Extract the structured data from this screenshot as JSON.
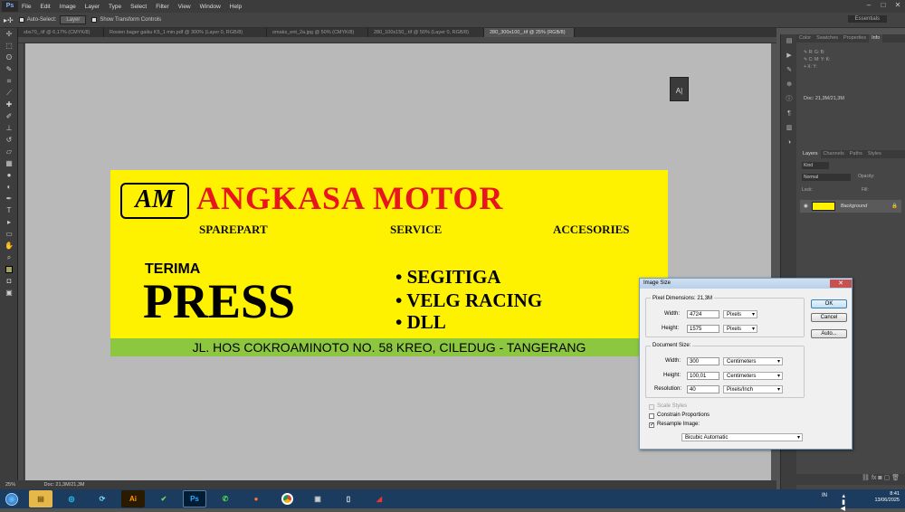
{
  "app": {
    "logo": "Ps",
    "menu": [
      "File",
      "Edit",
      "Image",
      "Layer",
      "Type",
      "Select",
      "Filter",
      "View",
      "Window",
      "Help"
    ]
  },
  "options": {
    "auto_select_label": "Auto-Select:",
    "auto_select_value": "Layer",
    "show_transform_label": "Show Transform Controls",
    "workspace": "Essentials"
  },
  "doc_tabs": [
    "sbs70_.tif @ 6,17% (CMYK/8)",
    "Rosien bager gaiku K5_1 min.pdf @ 300% (Layer 0, RGB/8)",
    "omaks_ent_2a.jpg @ 50% (CMYK/8)",
    "280_100x150_.tif @ 50% (Layer 0, RGB/8)",
    "280_300x100_.tif @ 25% (RGB/8)"
  ],
  "banner": {
    "logo_text": "AM",
    "brand": "ANGKASA MOTOR",
    "subs": [
      "SPAREPART",
      "SERVICE",
      "ACCESORIES"
    ],
    "terima": "TERIMA",
    "press": "PRESS",
    "bullets": [
      "• SEGITIGA",
      "• VELG RACING",
      "• DLL"
    ],
    "address": "JL. HOS COKROAMINOTO NO. 58 KREO, CILEDUG - TANGERANG",
    "colors": {
      "bg": "#fff200",
      "brand": "#e8151c",
      "strip": "#8dc63f"
    }
  },
  "status": {
    "zoom": "25%",
    "doc": "Doc: 21,3M/21,3M"
  },
  "panels": {
    "top_tabs": [
      "Color",
      "Swatches",
      "Properties",
      "Info"
    ],
    "doc_info": "Doc: 21,3M/21,3M",
    "layer_tabs": [
      "Layers",
      "Channels",
      "Paths",
      "Styles"
    ],
    "kind": "Kind",
    "blend": "Normal",
    "opacity_label": "Opacity:",
    "fill_label": "Fill:",
    "lock_label": "Lock:",
    "layer_name": "Background"
  },
  "dialog": {
    "title": "Image Size",
    "pixel_dim_label": "Pixel Dimensions:",
    "pixel_dim_value": "21,3M",
    "width_label": "Width:",
    "width_px": "4724",
    "height_label": "Height:",
    "height_px": "1575",
    "px_unit": "Pixels",
    "doc_size_label": "Document Size:",
    "width_cm": "300",
    "height_cm": "100,01",
    "cm_unit": "Centimeters",
    "resolution_label": "Resolution:",
    "resolution": "40",
    "res_unit": "Pixels/Inch",
    "scale_styles": "Scale Styles",
    "constrain": "Constrain Proportions",
    "resample": "Resample Image:",
    "resample_method": "Bicubic Automatic",
    "ok": "OK",
    "cancel": "Cancel",
    "auto": "Auto..."
  },
  "taskbar": {
    "time": "8:41",
    "date": "13/06/2025",
    "lang": "IN"
  }
}
